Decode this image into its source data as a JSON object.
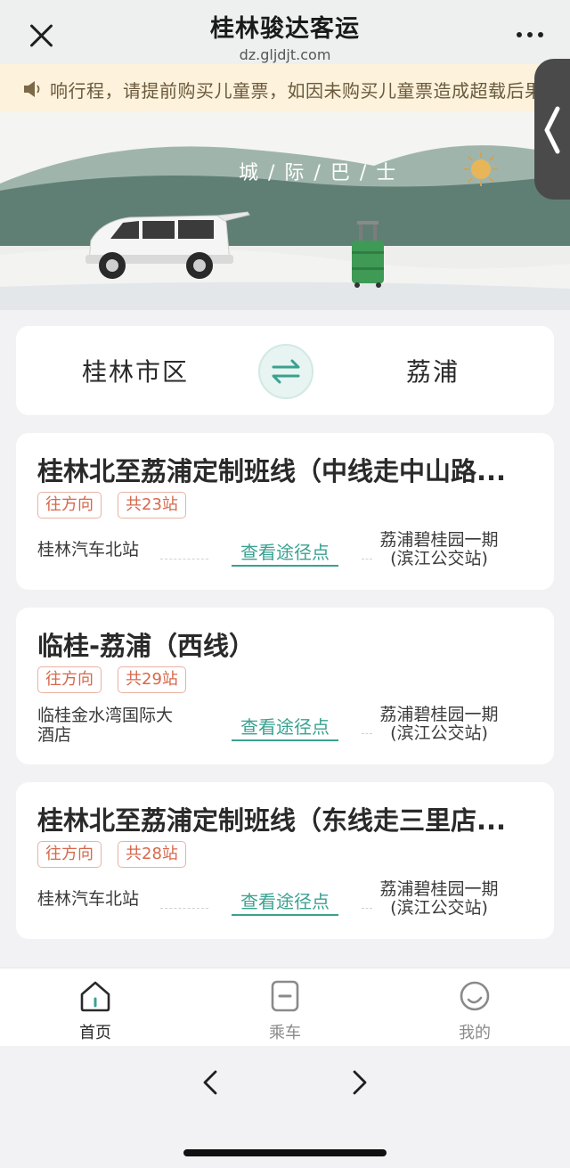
{
  "header": {
    "title": "桂林骏达客运",
    "url": "dz.gljdjt.com"
  },
  "notice": {
    "text": "响行程，请提前购买儿童票，如因未购买儿童票造成超载后果"
  },
  "banner": {
    "text": "城/际/巴/士"
  },
  "route": {
    "from": "桂林市区",
    "to": "荔浦"
  },
  "lines": [
    {
      "title": "桂林北至荔浦定制班线（中线走中山路...",
      "direction": "往方向",
      "stations": "共23站",
      "start": "桂林汽车北站",
      "view_label": "查看途径点",
      "end_line1": "荔浦碧桂园一期",
      "end_line2": "(滨江公交站)"
    },
    {
      "title": "临桂-荔浦（西线）",
      "direction": "往方向",
      "stations": "共29站",
      "start": "临桂金水湾国际大酒店",
      "view_label": "查看途径点",
      "end_line1": "荔浦碧桂园一期",
      "end_line2": "(滨江公交站)"
    },
    {
      "title": "桂林北至荔浦定制班线（东线走三里店...",
      "direction": "往方向",
      "stations": "共28站",
      "start": "桂林汽车北站",
      "view_label": "查看途径点",
      "end_line1": "荔浦碧桂园一期",
      "end_line2": "(滨江公交站)"
    }
  ],
  "tabbar": {
    "home": "首页",
    "ride": "乘车",
    "mine": "我的"
  },
  "colors": {
    "accent": "#3aa190",
    "tag": "#d6684c",
    "notice_bg": "#fdf2dc"
  }
}
